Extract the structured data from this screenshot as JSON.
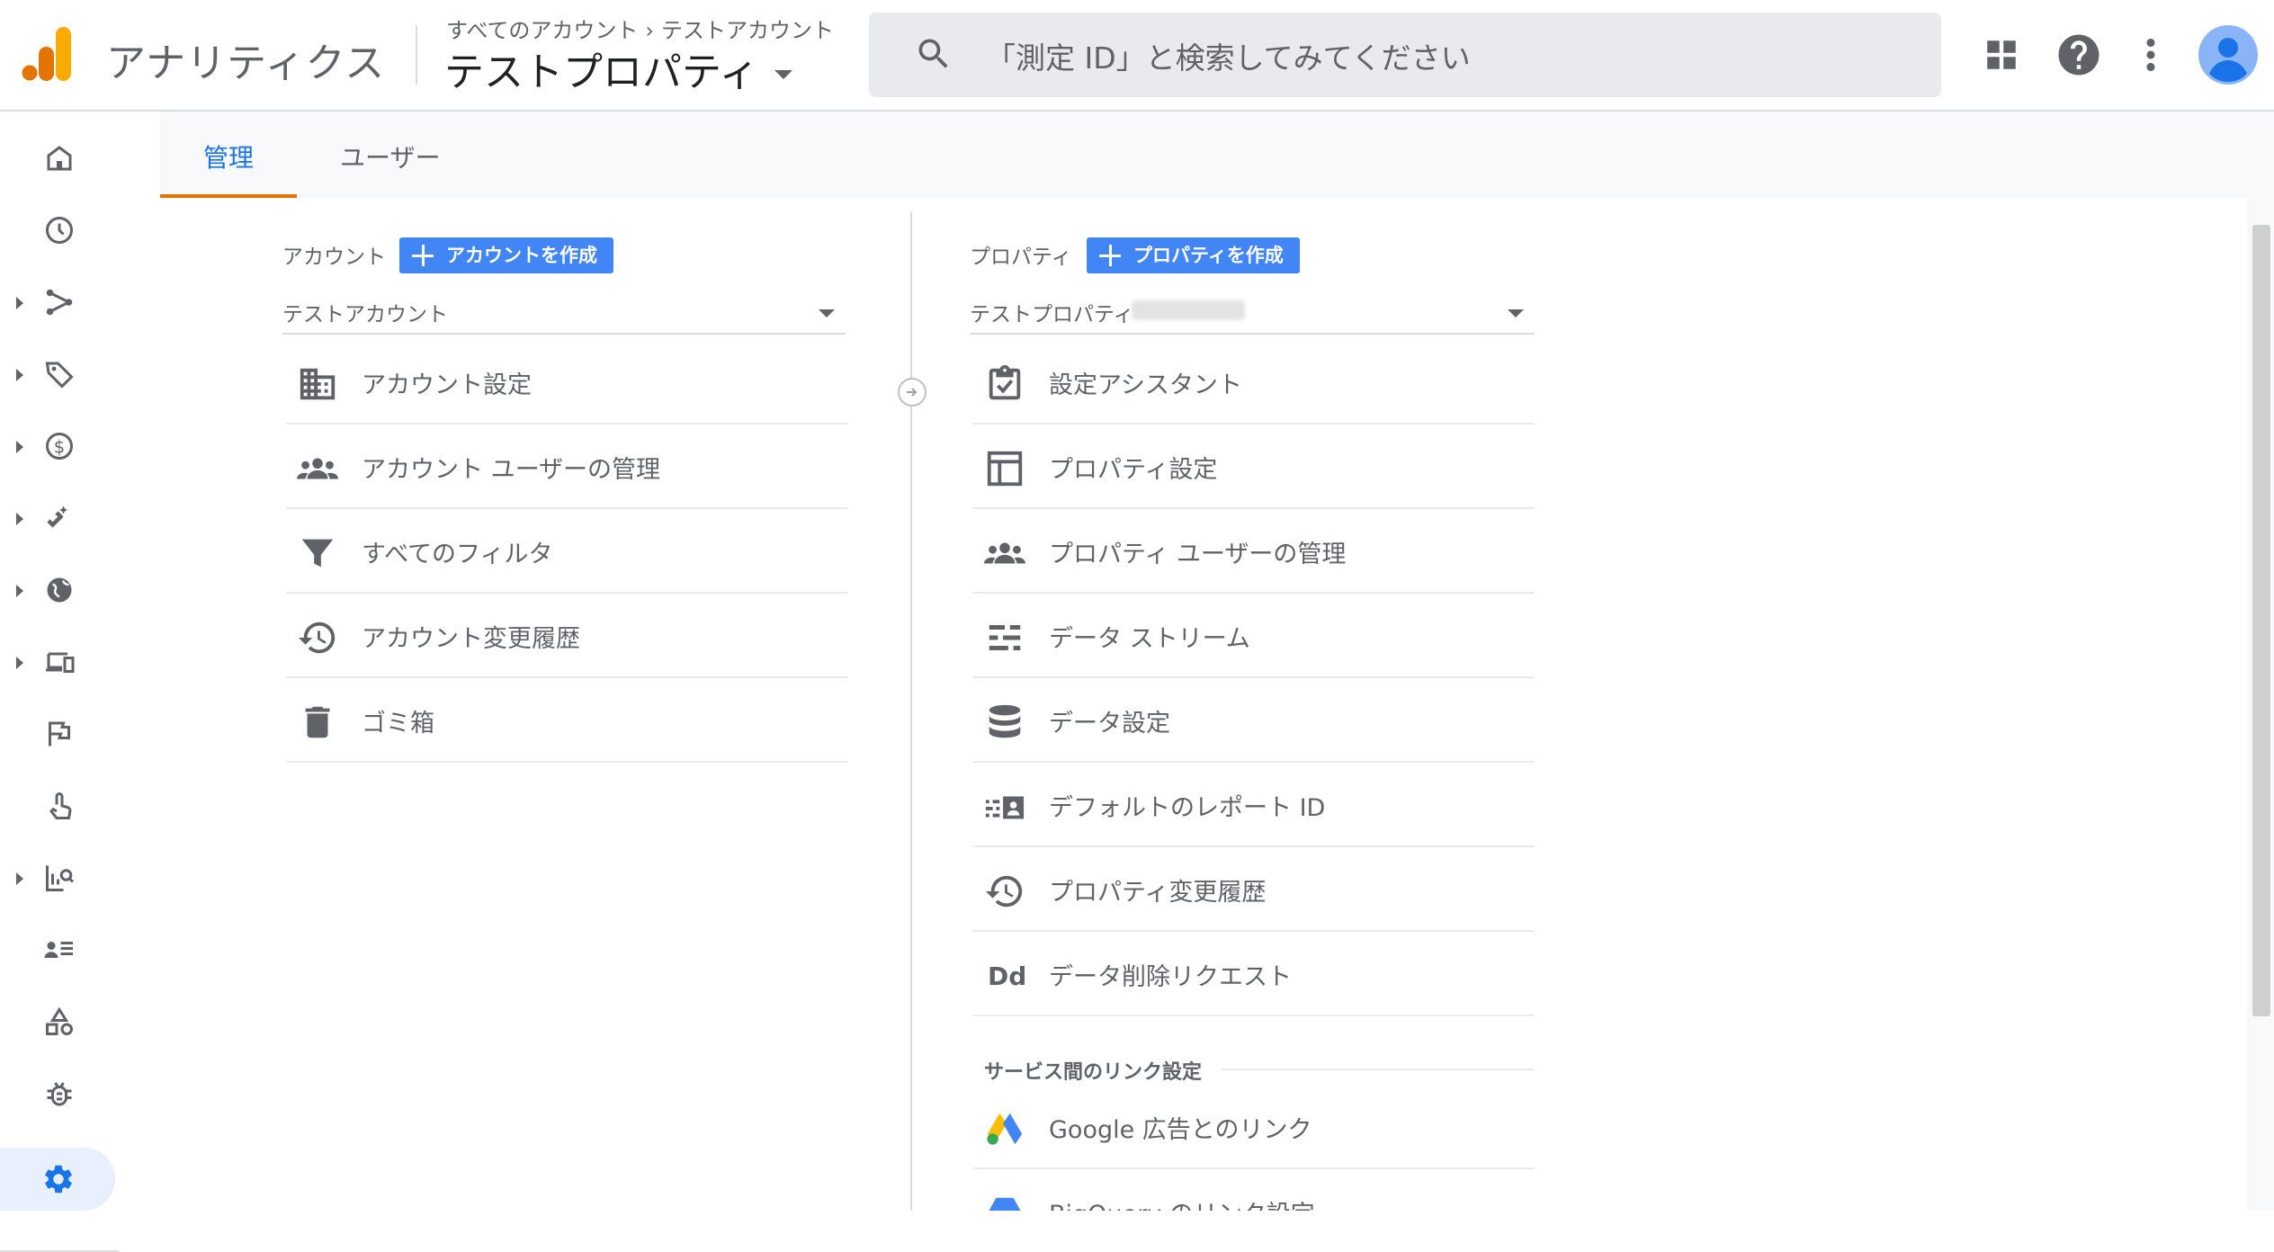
{
  "header": {
    "app_name": "アナリティクス",
    "breadcrumb": [
      "すべてのアカウント",
      "テストアカウント"
    ],
    "breadcrumb_separator": "›",
    "property_title": "テストプロパティ",
    "search_placeholder": "「測定 ID」と検索してみてください",
    "logo_colors": [
      "#f9ab00",
      "#e37400"
    ]
  },
  "nav": {
    "items": [
      {
        "icon": "home-icon",
        "expandable": false
      },
      {
        "icon": "clock-icon",
        "expandable": false
      },
      {
        "icon": "fork-icon",
        "expandable": true
      },
      {
        "icon": "tag-icon",
        "expandable": true
      },
      {
        "icon": "dollar-icon",
        "expandable": true
      },
      {
        "icon": "magnet-icon",
        "expandable": true
      },
      {
        "icon": "globe-icon",
        "expandable": true
      },
      {
        "icon": "devices-icon",
        "expandable": true
      },
      {
        "icon": "flag-icon",
        "expandable": false
      },
      {
        "icon": "touch-icon",
        "expandable": false
      },
      {
        "icon": "report-search-icon",
        "expandable": true
      },
      {
        "icon": "list-person-icon",
        "expandable": false
      },
      {
        "icon": "shapes-icon",
        "expandable": false
      },
      {
        "icon": "bug-icon",
        "expandable": false
      }
    ],
    "active_icon": "gear-icon"
  },
  "tabs": [
    {
      "label": "管理",
      "active": true
    },
    {
      "label": "ユーザー",
      "active": false
    }
  ],
  "account": {
    "label": "アカウント",
    "create_button": "アカウントを作成",
    "selected": "テストアカウント",
    "items": [
      {
        "icon": "building-icon",
        "label": "アカウント設定"
      },
      {
        "icon": "people-icon",
        "label": "アカウント ユーザーの管理"
      },
      {
        "icon": "filter-icon",
        "label": "すべてのフィルタ"
      },
      {
        "icon": "history-icon",
        "label": "アカウント変更履歴"
      },
      {
        "icon": "trash-icon",
        "label": "ゴミ箱"
      }
    ]
  },
  "property": {
    "label": "プロパティ",
    "create_button": "プロパティを作成",
    "selected": "テストプロパティ",
    "items": [
      {
        "icon": "checklist-icon",
        "label": "設定アシスタント"
      },
      {
        "icon": "layout-icon",
        "label": "プロパティ設定"
      },
      {
        "icon": "people-icon",
        "label": "プロパティ ユーザーの管理"
      },
      {
        "icon": "streams-icon",
        "label": "データ ストリーム"
      },
      {
        "icon": "database-icon",
        "label": "データ設定"
      },
      {
        "icon": "id-card-icon",
        "label": "デフォルトのレポート ID"
      },
      {
        "icon": "history-icon",
        "label": "プロパティ変更履歴"
      },
      {
        "icon": "dd-icon",
        "label": "データ削除リクエスト"
      }
    ],
    "links_section": "サービス間のリンク設定",
    "links": [
      {
        "icon": "google-ads-icon",
        "label": "Google 広告とのリンク"
      },
      {
        "icon": "bigquery-icon",
        "label": "BigQuery のリンク設定"
      }
    ]
  },
  "colors": {
    "accent": "#1a73e8",
    "tab_indicator": "#e37400",
    "button": "#4285f4"
  }
}
